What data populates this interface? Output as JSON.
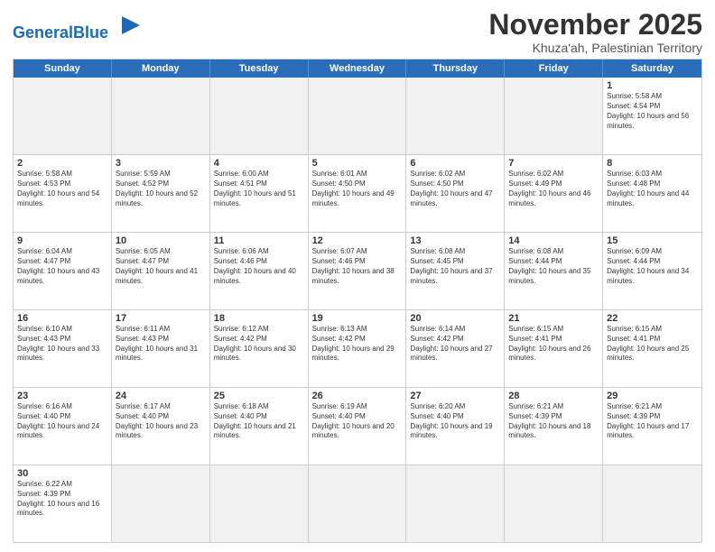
{
  "logo": {
    "text_general": "General",
    "text_blue": "Blue"
  },
  "title": "November 2025",
  "location": "Khuza'ah, Palestinian Territory",
  "days_of_week": [
    "Sunday",
    "Monday",
    "Tuesday",
    "Wednesday",
    "Thursday",
    "Friday",
    "Saturday"
  ],
  "weeks": [
    [
      {
        "day": "",
        "empty": true
      },
      {
        "day": "",
        "empty": true
      },
      {
        "day": "",
        "empty": true
      },
      {
        "day": "",
        "empty": true
      },
      {
        "day": "",
        "empty": true
      },
      {
        "day": "",
        "empty": true
      },
      {
        "day": "1",
        "sun": "Sunrise: 5:58 AM",
        "set": "Sunset: 4:54 PM",
        "day_len": "Daylight: 10 hours and 56 minutes."
      }
    ],
    [
      {
        "day": "2",
        "sun": "Sunrise: 5:58 AM",
        "set": "Sunset: 4:53 PM",
        "day_len": "Daylight: 10 hours and 54 minutes."
      },
      {
        "day": "3",
        "sun": "Sunrise: 5:59 AM",
        "set": "Sunset: 4:52 PM",
        "day_len": "Daylight: 10 hours and 52 minutes."
      },
      {
        "day": "4",
        "sun": "Sunrise: 6:00 AM",
        "set": "Sunset: 4:51 PM",
        "day_len": "Daylight: 10 hours and 51 minutes."
      },
      {
        "day": "5",
        "sun": "Sunrise: 6:01 AM",
        "set": "Sunset: 4:50 PM",
        "day_len": "Daylight: 10 hours and 49 minutes."
      },
      {
        "day": "6",
        "sun": "Sunrise: 6:02 AM",
        "set": "Sunset: 4:50 PM",
        "day_len": "Daylight: 10 hours and 47 minutes."
      },
      {
        "day": "7",
        "sun": "Sunrise: 6:02 AM",
        "set": "Sunset: 4:49 PM",
        "day_len": "Daylight: 10 hours and 46 minutes."
      },
      {
        "day": "8",
        "sun": "Sunrise: 6:03 AM",
        "set": "Sunset: 4:48 PM",
        "day_len": "Daylight: 10 hours and 44 minutes."
      }
    ],
    [
      {
        "day": "9",
        "sun": "Sunrise: 6:04 AM",
        "set": "Sunset: 4:47 PM",
        "day_len": "Daylight: 10 hours and 43 minutes."
      },
      {
        "day": "10",
        "sun": "Sunrise: 6:05 AM",
        "set": "Sunset: 4:47 PM",
        "day_len": "Daylight: 10 hours and 41 minutes."
      },
      {
        "day": "11",
        "sun": "Sunrise: 6:06 AM",
        "set": "Sunset: 4:46 PM",
        "day_len": "Daylight: 10 hours and 40 minutes."
      },
      {
        "day": "12",
        "sun": "Sunrise: 6:07 AM",
        "set": "Sunset: 4:46 PM",
        "day_len": "Daylight: 10 hours and 38 minutes."
      },
      {
        "day": "13",
        "sun": "Sunrise: 6:08 AM",
        "set": "Sunset: 4:45 PM",
        "day_len": "Daylight: 10 hours and 37 minutes."
      },
      {
        "day": "14",
        "sun": "Sunrise: 6:08 AM",
        "set": "Sunset: 4:44 PM",
        "day_len": "Daylight: 10 hours and 35 minutes."
      },
      {
        "day": "15",
        "sun": "Sunrise: 6:09 AM",
        "set": "Sunset: 4:44 PM",
        "day_len": "Daylight: 10 hours and 34 minutes."
      }
    ],
    [
      {
        "day": "16",
        "sun": "Sunrise: 6:10 AM",
        "set": "Sunset: 4:43 PM",
        "day_len": "Daylight: 10 hours and 33 minutes."
      },
      {
        "day": "17",
        "sun": "Sunrise: 6:11 AM",
        "set": "Sunset: 4:43 PM",
        "day_len": "Daylight: 10 hours and 31 minutes."
      },
      {
        "day": "18",
        "sun": "Sunrise: 6:12 AM",
        "set": "Sunset: 4:42 PM",
        "day_len": "Daylight: 10 hours and 30 minutes."
      },
      {
        "day": "19",
        "sun": "Sunrise: 6:13 AM",
        "set": "Sunset: 4:42 PM",
        "day_len": "Daylight: 10 hours and 29 minutes."
      },
      {
        "day": "20",
        "sun": "Sunrise: 6:14 AM",
        "set": "Sunset: 4:42 PM",
        "day_len": "Daylight: 10 hours and 27 minutes."
      },
      {
        "day": "21",
        "sun": "Sunrise: 6:15 AM",
        "set": "Sunset: 4:41 PM",
        "day_len": "Daylight: 10 hours and 26 minutes."
      },
      {
        "day": "22",
        "sun": "Sunrise: 6:15 AM",
        "set": "Sunset: 4:41 PM",
        "day_len": "Daylight: 10 hours and 25 minutes."
      }
    ],
    [
      {
        "day": "23",
        "sun": "Sunrise: 6:16 AM",
        "set": "Sunset: 4:40 PM",
        "day_len": "Daylight: 10 hours and 24 minutes."
      },
      {
        "day": "24",
        "sun": "Sunrise: 6:17 AM",
        "set": "Sunset: 4:40 PM",
        "day_len": "Daylight: 10 hours and 23 minutes."
      },
      {
        "day": "25",
        "sun": "Sunrise: 6:18 AM",
        "set": "Sunset: 4:40 PM",
        "day_len": "Daylight: 10 hours and 21 minutes."
      },
      {
        "day": "26",
        "sun": "Sunrise: 6:19 AM",
        "set": "Sunset: 4:40 PM",
        "day_len": "Daylight: 10 hours and 20 minutes."
      },
      {
        "day": "27",
        "sun": "Sunrise: 6:20 AM",
        "set": "Sunset: 4:40 PM",
        "day_len": "Daylight: 10 hours and 19 minutes."
      },
      {
        "day": "28",
        "sun": "Sunrise: 6:21 AM",
        "set": "Sunset: 4:39 PM",
        "day_len": "Daylight: 10 hours and 18 minutes."
      },
      {
        "day": "29",
        "sun": "Sunrise: 6:21 AM",
        "set": "Sunset: 4:39 PM",
        "day_len": "Daylight: 10 hours and 17 minutes."
      }
    ],
    [
      {
        "day": "30",
        "sun": "Sunrise: 6:22 AM",
        "set": "Sunset: 4:39 PM",
        "day_len": "Daylight: 10 hours and 16 minutes."
      },
      {
        "day": "",
        "empty": true
      },
      {
        "day": "",
        "empty": true
      },
      {
        "day": "",
        "empty": true
      },
      {
        "day": "",
        "empty": true
      },
      {
        "day": "",
        "empty": true
      },
      {
        "day": "",
        "empty": true
      }
    ]
  ]
}
